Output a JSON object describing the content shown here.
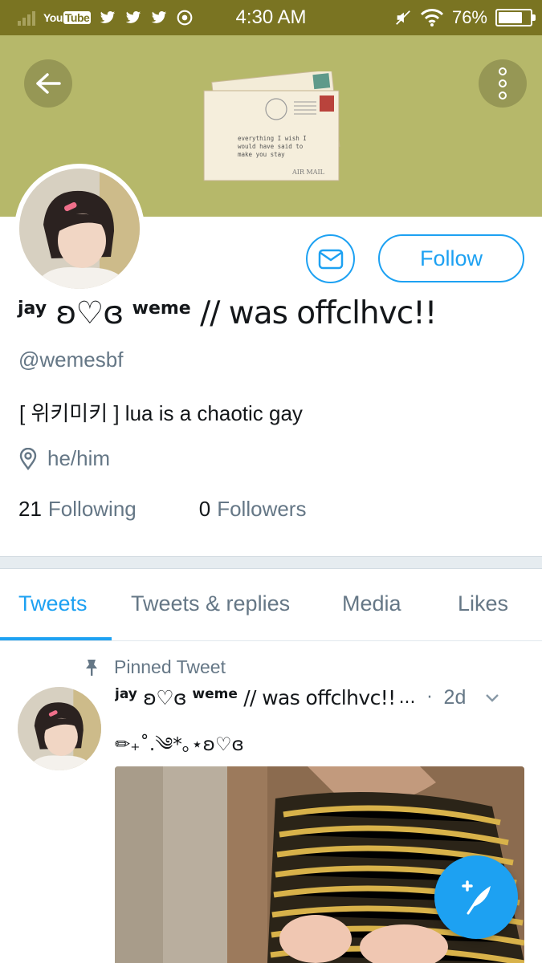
{
  "status_bar": {
    "time": "4:30 AM",
    "battery": "76%",
    "battery_level": 0.76,
    "notification_icons": [
      "youtube-icon",
      "twitter-icon",
      "twitter-icon",
      "twitter-icon",
      "chrome-icon"
    ],
    "youtube_label": "You",
    "youtube_label_box": "Tube"
  },
  "banner": {
    "color": "#b6b86a",
    "envelope_text": [
      "everything I wish I",
      "would have said to",
      "make you stay"
    ],
    "envelope_stamp_text": "AIR MAIL"
  },
  "actions": {
    "follow_label": "Follow",
    "accent_color": "#1da1f2"
  },
  "profile": {
    "name_prefix": "jay",
    "name_symbol": " ʚ♡ɞ ",
    "name_middle": "weme",
    "name_suffix": " // was offclhvc!!",
    "handle": "@wemesbf",
    "bio": "[ 위키미키 ] lua is a chaotic gay",
    "location": "he/him",
    "following_count": "21",
    "following_label": "Following",
    "followers_count": "0",
    "followers_label": "Followers"
  },
  "tabs": [
    {
      "label": "Tweets",
      "active": true
    },
    {
      "label": "Tweets & replies",
      "active": false
    },
    {
      "label": "Media",
      "active": false
    },
    {
      "label": "Likes",
      "active": false
    }
  ],
  "pinned_tweet": {
    "pinned_label": "Pinned Tweet",
    "author_prefix": "jay",
    "author_symbol": " ʚ♡ɞ ",
    "author_middle": "weme",
    "author_suffix": " // was offclhvc!!",
    "ellipsis": "...",
    "separator": "·",
    "time": "2d",
    "text": "✏︎₊˚.༄*｡⋆ʚ♡ɞ"
  }
}
